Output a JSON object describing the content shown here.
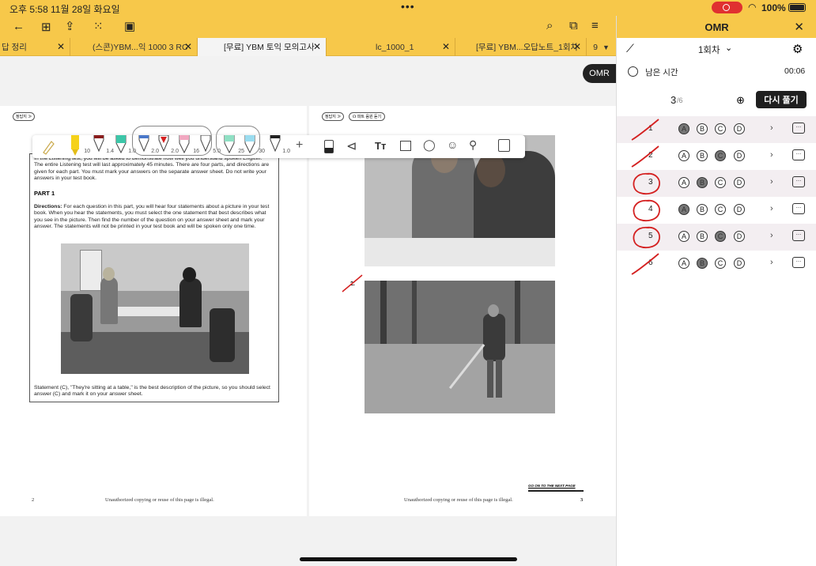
{
  "status": {
    "time": "오후 5:58",
    "date": "11월 28일 화요일",
    "battery": "100%",
    "dots": "•••"
  },
  "tabs": [
    {
      "label": "답 정리"
    },
    {
      "label": "(스콘)YBM...익 1000 3 RC"
    },
    {
      "label": "[무료] YBM 토익 모의고사"
    },
    {
      "label": "lc_1000_1"
    },
    {
      "label": "[무료] YBM...오답노트_1회차"
    },
    {
      "label": "9"
    }
  ],
  "omr": {
    "title": "OMR",
    "round": "1회차",
    "remaining_label": "남은 시간",
    "remaining_time": "00:06",
    "progress_current": "3",
    "progress_total": "/6",
    "retry_label": "다시 풀기",
    "questions": [
      {
        "num": "1",
        "selected": "A",
        "mark": "slash"
      },
      {
        "num": "2",
        "selected": "C",
        "mark": "slash"
      },
      {
        "num": "3",
        "selected": "B",
        "mark": "circle"
      },
      {
        "num": "4",
        "selected": "A",
        "mark": "circle"
      },
      {
        "num": "5",
        "selected": "C",
        "mark": "circle"
      },
      {
        "num": "6",
        "selected": "B",
        "mark": "slash"
      }
    ],
    "choices": [
      "A",
      "B",
      "C",
      "D"
    ],
    "comment_icon": "…"
  },
  "omr_button": "OMR",
  "pen_tools": {
    "sizes": [
      "10",
      "1.4",
      "1.0",
      "2.0",
      "2.0",
      "16",
      "5.0",
      "25",
      "30",
      "1.0"
    ],
    "text_tool": "Tт",
    "plus": "+"
  },
  "page_left": {
    "badge": "정답지 ≫",
    "intro": "In the Listening test, you will be asked to demonstrate how well you understand spoken English. The entire Listening test will last approximately 45 minutes. There are four parts, and directions are given for each part. You must mark your answers on the separate answer sheet. Do not write your answers in your test book.",
    "part": "PART 1",
    "directions_label": "Directions:",
    "directions": " For each question in this part, you will hear four statements about a picture in your test book. When you hear the statements, you must select the one statement that best describes what you see in the picture. Then find the number of the question on your answer sheet and mark your answer. The statements will not be printed in your test book and will be spoken only one time.",
    "example": "Statement (C), \"They're sitting at a table,\" is the best description of the picture, so you should select answer (C) and mark it on your answer sheet.",
    "page_num": "2",
    "footer": "Unauthorized copying or reuse of this page is illegal."
  },
  "page_right": {
    "badge1": "정답지 ≫",
    "badge2": "☊ 파트 음원 듣기",
    "q2": "2.",
    "go_on": "GO ON TO THE NEXT PAGE",
    "page_num": "3",
    "footer": "Unauthorized copying or reuse of this page is illegal."
  },
  "colors": {
    "accent_yellow": "#f7c84a",
    "ink_red": "#d42020"
  }
}
